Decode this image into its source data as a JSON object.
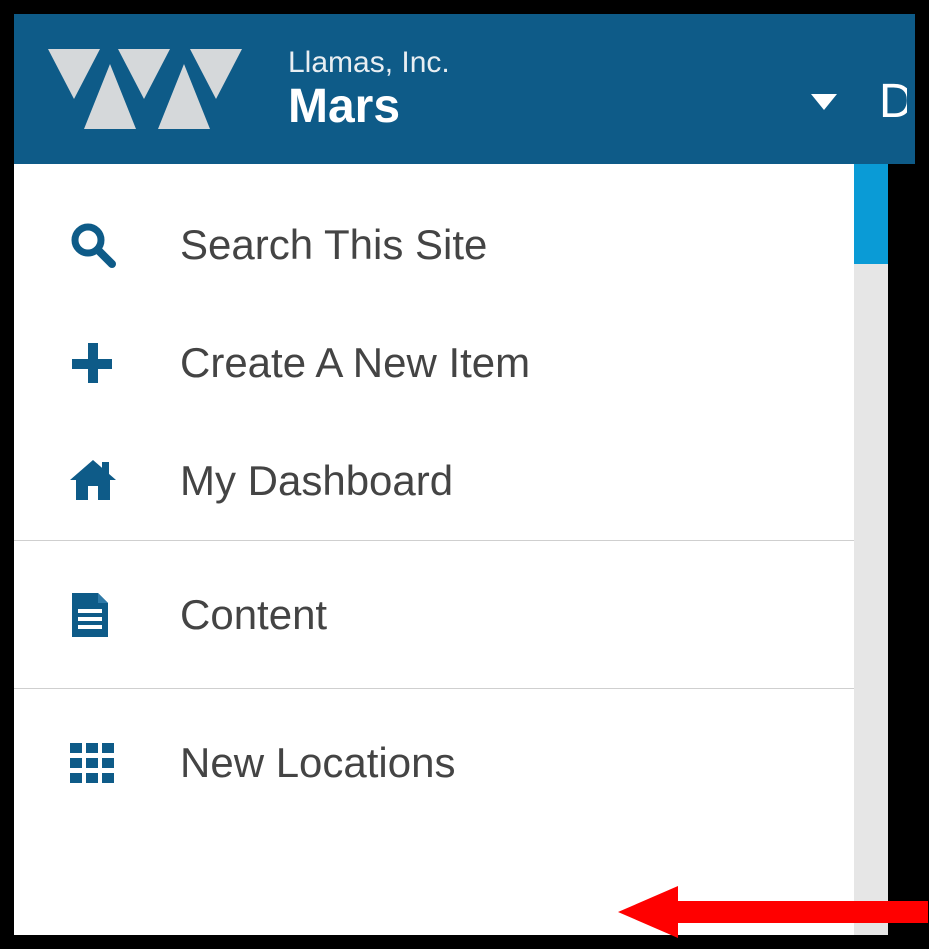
{
  "header": {
    "org_name": "Llamas, Inc.",
    "site_name": "Mars",
    "truncated_nav_letter": "D"
  },
  "sidebar": {
    "items": [
      {
        "label": "Search This Site"
      },
      {
        "label": "Create A New Item"
      },
      {
        "label": "My Dashboard"
      },
      {
        "label": "Content"
      },
      {
        "label": "New Locations"
      }
    ]
  }
}
